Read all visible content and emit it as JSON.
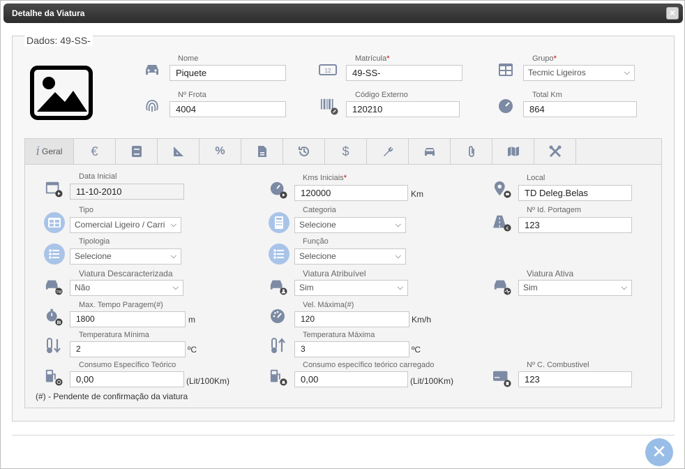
{
  "window": {
    "title": "Detalhe da Viatura",
    "close_label": "×"
  },
  "legend": "Dados: 49-SS-",
  "header": {
    "nome": {
      "label": "Nome",
      "value": "Piquete"
    },
    "matricula": {
      "label": "Matrícula",
      "value": "49-SS-"
    },
    "grupo": {
      "label": "Grupo",
      "value": "Tecmic Ligeiros"
    },
    "frota": {
      "label": "Nº Frota",
      "value": "4004"
    },
    "codigo": {
      "label": "Código Externo",
      "value": "120210"
    },
    "totalkm": {
      "label": "Total Km",
      "value": "864"
    },
    "required_mark": "*"
  },
  "tabs": [
    {
      "label": "Geral",
      "icon": "info-icon"
    },
    {
      "label": "",
      "icon": "euro-icon"
    },
    {
      "label": "",
      "icon": "book-icon"
    },
    {
      "label": "",
      "icon": "ruler-icon"
    },
    {
      "label": "",
      "icon": "percent-icon"
    },
    {
      "label": "",
      "icon": "document-icon"
    },
    {
      "label": "",
      "icon": "history-icon"
    },
    {
      "label": "",
      "icon": "dollar-icon"
    },
    {
      "label": "",
      "icon": "wrench-icon"
    },
    {
      "label": "",
      "icon": "car-front-icon"
    },
    {
      "label": "",
      "icon": "paperclip-icon"
    },
    {
      "label": "",
      "icon": "map-icon"
    },
    {
      "label": "",
      "icon": "tools-icon"
    }
  ],
  "geral": {
    "data_inicial": {
      "label": "Data Inicial",
      "value": "11-10-2010"
    },
    "kms_iniciais": {
      "label": "Kms Iniciais",
      "value": "120000",
      "unit": "Km"
    },
    "local": {
      "label": "Local",
      "value": "TD Deleg.Belas"
    },
    "tipo": {
      "label": "Tipo",
      "value": "Comercial Ligeiro / Carri"
    },
    "categoria": {
      "label": "Categoria",
      "value": "Selecione"
    },
    "portagem": {
      "label": "Nº Id. Portagem",
      "value": "123"
    },
    "tipologia": {
      "label": "Tipologia",
      "value": "Selecione"
    },
    "funcao": {
      "label": "Função",
      "value": "Selecione"
    },
    "descaracterizada": {
      "label": "Viatura Descaracterizada",
      "value": "Não"
    },
    "atribuivel": {
      "label": "Viatura Atribuível",
      "value": "Sim"
    },
    "ativa": {
      "label": "Viatura Ativa",
      "value": "Sim"
    },
    "tempo_paragem": {
      "label": "Max. Tempo Paragem(#)",
      "value": "1800",
      "unit": "m"
    },
    "vel_maxima": {
      "label": "Vel. Máxima(#)",
      "value": "120",
      "unit": "Km/h"
    },
    "temp_min": {
      "label": "Temperatura Mínima",
      "value": "2",
      "unit": "ºC"
    },
    "temp_max": {
      "label": "Temperatura Máxima",
      "value": "3",
      "unit": "ºC"
    },
    "consumo": {
      "label": "Consumo Específico Teórico",
      "value": "0,00",
      "unit": "(Lit/100Km)"
    },
    "consumo_carregado": {
      "label": "Consumo específico teórico carregado",
      "value": "0,00",
      "unit": "(Lit/100Km)"
    },
    "combustivel": {
      "label": "Nº C. Combustivel",
      "value": "123"
    },
    "note": "(#) - Pendente de confirmação da viatura"
  },
  "colors": {
    "icon": "#7d8aa3",
    "icon_bg": "#a9c4e8",
    "fab": "#98bde6"
  }
}
